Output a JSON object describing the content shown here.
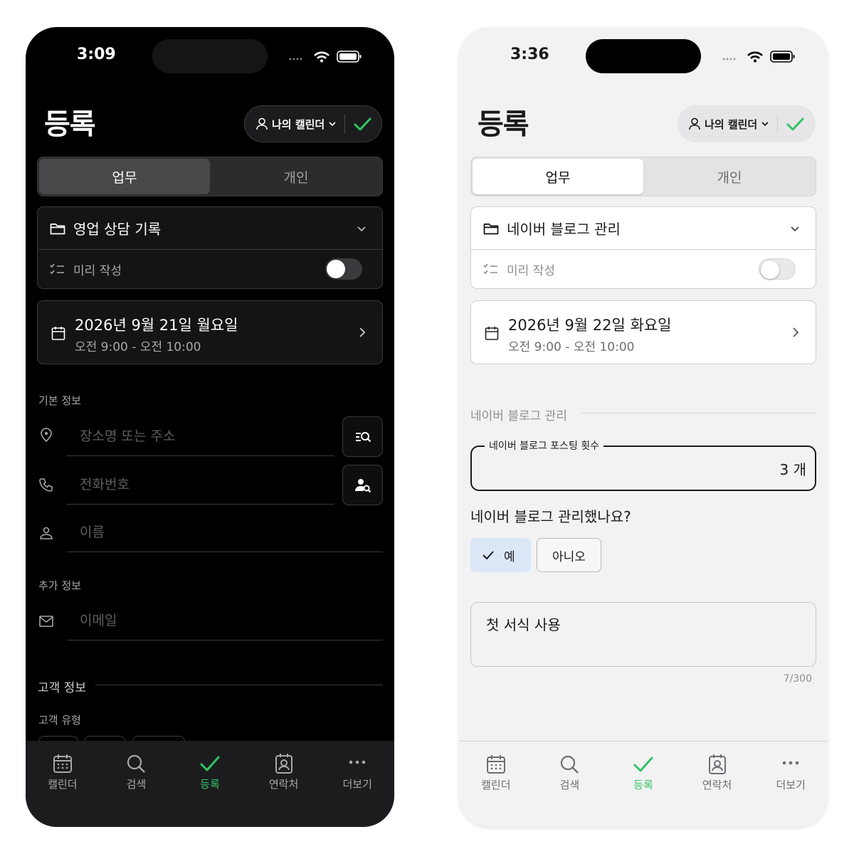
{
  "colors": {
    "accent_green": "#31c466",
    "dark_bg": "#000000",
    "light_bg": "#f2f2f3",
    "selected_option_bg": "#dbe7f7"
  },
  "dark": {
    "status": {
      "time": "3:09"
    },
    "header": {
      "title": "등록",
      "calendar_label": "나의 캘린더"
    },
    "segment": {
      "work": "업무",
      "personal": "개인",
      "selected": "업무"
    },
    "category": {
      "name": "영업 상담 기록",
      "draft_label": "미리 작성",
      "draft_on": false
    },
    "date": {
      "main": "2026년 9월 21일 월요일",
      "time": "오전 9:00 - 오전 10:00"
    },
    "basic_info": {
      "label": "기본 정보",
      "place_placeholder": "장소명 또는 주소",
      "phone_placeholder": "전화번호",
      "name_placeholder": "이름"
    },
    "extra_info": {
      "label": "추가 정보",
      "email_placeholder": "이메일"
    },
    "customer_info": {
      "label": "고객 정보",
      "type_label": "고객 유형"
    }
  },
  "light": {
    "status": {
      "time": "3:36"
    },
    "header": {
      "title": "등록",
      "calendar_label": "나의 캘린더"
    },
    "segment": {
      "work": "업무",
      "personal": "개인",
      "selected": "업무"
    },
    "category": {
      "name": "네이버 블로그 관리",
      "draft_label": "미리 작성",
      "draft_on": false
    },
    "date": {
      "main": "2026년 9월 22일 화요일",
      "time": "오전 9:00 - 오전 10:00"
    },
    "group": {
      "title": "네이버 블로그 관리",
      "posting_label": "네이버 블로그 포스팅 횟수",
      "posting_value": "3 개",
      "question": "네이버 블로그 관리했나요?",
      "yes": "예",
      "no": "아니오",
      "selected": "예"
    },
    "memo": {
      "text": "첫 서식 사용",
      "counter": "7/300"
    }
  },
  "tabbar": {
    "items": [
      {
        "label": "캘린더",
        "icon": "calendar-icon"
      },
      {
        "label": "검색",
        "icon": "search-icon"
      },
      {
        "label": "등록",
        "icon": "check-icon"
      },
      {
        "label": "연락처",
        "icon": "contacts-icon"
      },
      {
        "label": "더보기",
        "icon": "more-icon"
      }
    ],
    "active": "등록"
  }
}
